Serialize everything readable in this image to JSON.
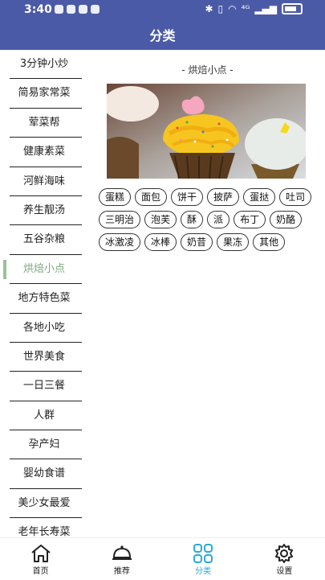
{
  "status": {
    "time": "3:40",
    "network": "⁴ᴳ"
  },
  "header": {
    "title": "分类"
  },
  "sidebar": {
    "items": [
      {
        "label": "3分钟小炒"
      },
      {
        "label": "简易家常菜"
      },
      {
        "label": "荤菜帮"
      },
      {
        "label": "健康素菜"
      },
      {
        "label": "河鲜海味"
      },
      {
        "label": "养生靓汤"
      },
      {
        "label": "五谷杂粮"
      },
      {
        "label": "烘焙小点"
      },
      {
        "label": "地方特色菜"
      },
      {
        "label": "各地小吃"
      },
      {
        "label": "世界美食"
      },
      {
        "label": "一日三餐"
      },
      {
        "label": "人群"
      },
      {
        "label": "孕产妇"
      },
      {
        "label": "婴幼食谱"
      },
      {
        "label": "美少女最爱"
      },
      {
        "label": "老年长寿菜"
      }
    ],
    "active_index": 7
  },
  "content": {
    "section_title": "- 烘焙小点 -",
    "tags": [
      "蛋糕",
      "面包",
      "饼干",
      "披萨",
      "蛋挞",
      "吐司",
      "三明治",
      "泡芙",
      "酥",
      "派",
      "布丁",
      "奶酪",
      "冰激凌",
      "冰棒",
      "奶昔",
      "果冻",
      "其他"
    ]
  },
  "bottom_nav": {
    "items": [
      {
        "label": "首页",
        "icon": "home-icon"
      },
      {
        "label": "推荐",
        "icon": "cloche-icon"
      },
      {
        "label": "分类",
        "icon": "grid-icon"
      },
      {
        "label": "设置",
        "icon": "gear-icon"
      }
    ],
    "active_index": 2
  },
  "colors": {
    "header": "#4b5aa7",
    "active_nav": "#2aa9d6",
    "active_sidebar": "#7ea77e"
  }
}
